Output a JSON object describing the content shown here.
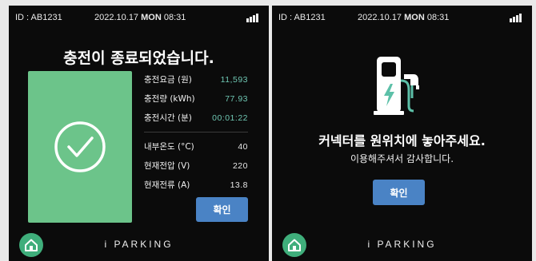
{
  "status_bar": {
    "device_id": "ID : AB1231",
    "date": "2022.10.17",
    "weekday": "MON",
    "time": "08:31"
  },
  "complete_screen": {
    "title": "충전이 종료되었습니다.",
    "charge_metrics": [
      {
        "label": "충전요금 (원)",
        "value": "11,593"
      },
      {
        "label": "충전량 (kWh)",
        "value": "77.93"
      },
      {
        "label": "충전시간 (분)",
        "value": "00:01:22"
      }
    ],
    "environment_metrics": [
      {
        "label": "내부온도 (°C)",
        "value": "40"
      },
      {
        "label": "현재전압 (V)",
        "value": "220"
      },
      {
        "label": "현재전류 (A)",
        "value": "13.8"
      }
    ],
    "confirm_label": "확인"
  },
  "return_screen": {
    "message": "커넥터를 원위치에 놓아주세요.",
    "thanks": "이용해주셔서 감사합니다.",
    "confirm_label": "확인"
  },
  "footer": {
    "brand": "i PARKING",
    "home_icon": "home-icon"
  },
  "colors": {
    "accent_green": "#6cc48a",
    "value_teal": "#6fc7b3",
    "button_blue": "#4a83c5",
    "home_green": "#3fae7b"
  }
}
